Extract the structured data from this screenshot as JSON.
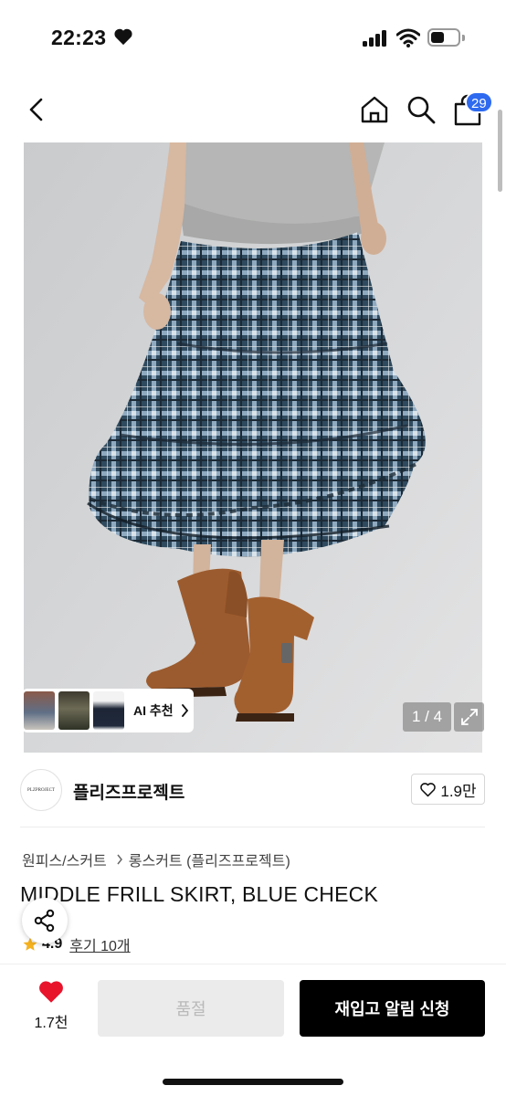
{
  "status_bar": {
    "time": "22:23"
  },
  "nav": {
    "cart_badge": "29"
  },
  "gallery": {
    "ai_label": "AI 추천",
    "page_indicator": "1 / 4",
    "current_page": 1,
    "total_pages": 4
  },
  "brand": {
    "logo_text": "PLZPROJECT",
    "name": "플리즈프로젝트",
    "likes": "1.9만"
  },
  "breadcrumb": {
    "category": "원피스/스커트",
    "subcategory": "롱스커트 (플리즈프로젝트)"
  },
  "product": {
    "title": "MIDDLE FRILL SKIRT, BLUE CHECK",
    "rating": "4.9",
    "reviews": "후기 10개"
  },
  "bottom_bar": {
    "wish_count": "1.7천",
    "soldout_label": "품절",
    "restock_label": "재입고 알림 신청"
  },
  "colors": {
    "badge": "#2e6af0",
    "heart": "#e8142c",
    "star": "#f5b21f",
    "primary_button": "#000000",
    "disabled_button": "#ebebeb"
  },
  "icons": [
    "heart-icon",
    "signal-icon",
    "wifi-icon",
    "battery-icon",
    "back-arrow-icon",
    "home-icon",
    "search-icon",
    "cart-icon",
    "expand-icon",
    "chevron-right-icon",
    "share-icon",
    "star-icon"
  ]
}
